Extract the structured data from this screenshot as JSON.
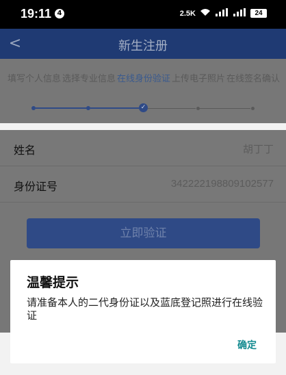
{
  "status_bar": {
    "time": "19:11",
    "notification_badge": "4",
    "net_speed": "2.5K",
    "signal1": "ıılİ",
    "signal2": ".ııl",
    "battery": "24"
  },
  "app_bar": {
    "back": "<",
    "title": "新生注册"
  },
  "stepper": {
    "steps": [
      {
        "label": "填写个人信息"
      },
      {
        "label": "选择专业信息"
      },
      {
        "label": "在线身份验证"
      },
      {
        "label": "上传电子照片"
      },
      {
        "label": "在线签名确认"
      }
    ],
    "current_step": 3,
    "check": "✓"
  },
  "form": {
    "name_label": "姓名",
    "name_value": "胡丁丁",
    "id_label": "身份证号",
    "id_value": "342222198809102577"
  },
  "verify_button": "立即验证",
  "dialog": {
    "title": "温馨提示",
    "message": "请准备本人的二代身份证以及蓝底登记照进行在线验证",
    "confirm": "确定"
  }
}
